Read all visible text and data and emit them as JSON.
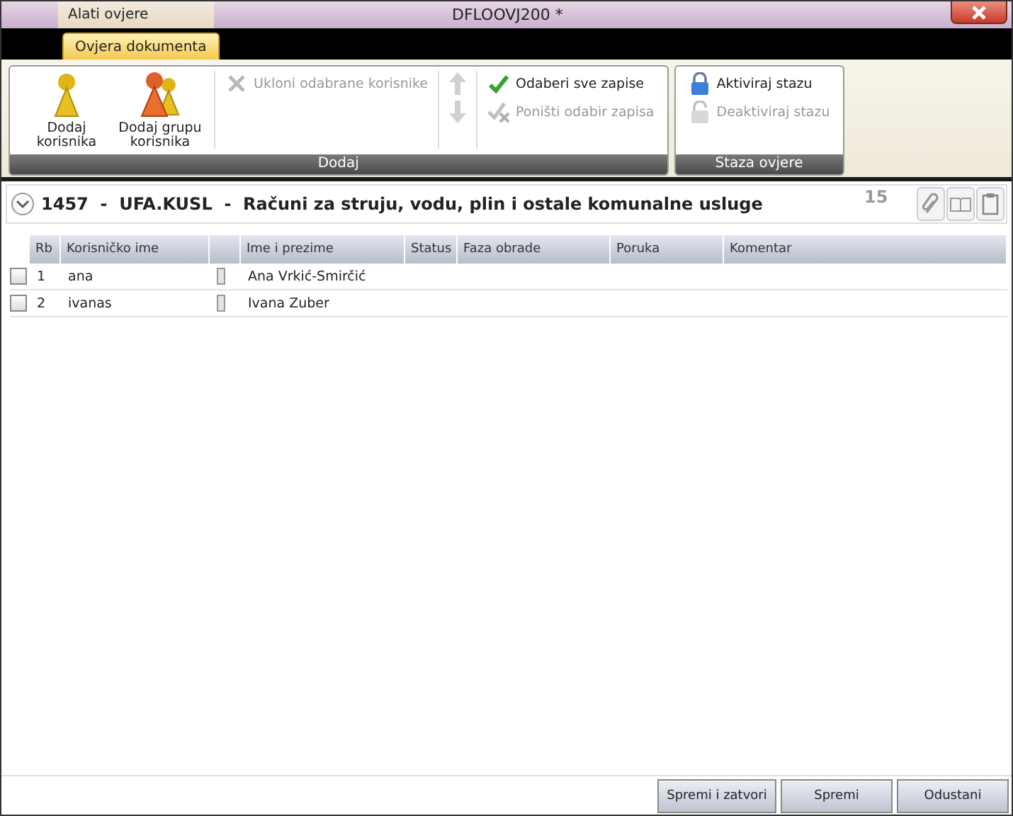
{
  "window": {
    "context_tab": "Alati ovjere",
    "title": "DFLOOVJ200 *"
  },
  "ribbon_tabs": [
    {
      "label": "Ovjera dokumenta",
      "selected": true
    }
  ],
  "ribbon_groups": [
    {
      "label": "Dodaj",
      "sections": [
        [
          {
            "kind": "person",
            "label": "Dodaj korisnika",
            "disabled": false
          },
          {
            "kind": "group",
            "label": "Dodaj grupu korisnika",
            "disabled": false
          }
        ],
        [
          {
            "kind": "remove",
            "label": "Ukloni odabrane korisnike",
            "disabled": true
          }
        ],
        [
          {
            "kind": "up",
            "disabled": true
          },
          {
            "kind": "down",
            "disabled": true
          }
        ],
        [
          {
            "kind": "check",
            "label": "Odaberi sve zapise",
            "disabled": false
          },
          {
            "kind": "uncheck",
            "label": "Poništi odabir zapisa",
            "disabled": true
          }
        ]
      ]
    },
    {
      "label": "Staza ovjere",
      "sections": [
        [
          {
            "kind": "lock",
            "label": "Aktiviraj stazu",
            "disabled": false
          },
          {
            "kind": "unlock",
            "label": "Deaktiviraj stazu",
            "disabled": true
          }
        ]
      ]
    }
  ],
  "document": {
    "expanded": true,
    "title": "1457  -  UFA.KUSL  -  Računi za struju, vodu, plin i ostale komunalne usluge",
    "count": "15"
  },
  "table": {
    "columns": [
      "Rb",
      "Korisničko ime",
      "Ime i prezime",
      "Status",
      "Faza obrade",
      "Poruka",
      "Komentar"
    ],
    "rows": [
      {
        "checked": false,
        "rb": "1",
        "username": "ana",
        "name": "Ana Vrkić-Smirčić"
      },
      {
        "checked": false,
        "rb": "2",
        "username": "ivanas",
        "name": "Ivana Zuber"
      }
    ]
  },
  "buttons": [
    "Spremi i zatvori",
    "Spremi",
    "Odustani"
  ]
}
